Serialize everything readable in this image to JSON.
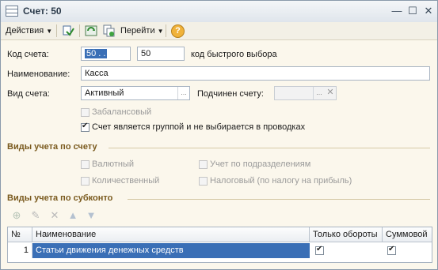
{
  "window": {
    "title": "Счет: 50"
  },
  "toolbar": {
    "actions_label": "Действия",
    "goto_label": "Перейти",
    "help_label": "?"
  },
  "form": {
    "code_label": "Код счета:",
    "code_value": "50 . .",
    "quick_code_value": "50",
    "quick_code_label": "код быстрого выбора",
    "name_label": "Наименование:",
    "name_value": "Касса",
    "type_label": "Вид счета:",
    "type_value": "Активный",
    "parent_label": "Подчинен счету:",
    "parent_value": "",
    "offbalance_label": "Забалансовый",
    "offbalance_checked": false,
    "group_label": "Счет является группой и не выбирается в проводках",
    "group_checked": true
  },
  "accounting_kinds": {
    "title": "Виды учета по счету",
    "currency_label": "Валютный",
    "quantity_label": "Количественный",
    "by_department_label": "Учет по подразделениям",
    "tax_label": "Налоговый (по налогу на прибыль)"
  },
  "subconto": {
    "title": "Виды учета по субконто",
    "columns": [
      "№",
      "Наименование",
      "Только обороты",
      "Суммовой"
    ],
    "rows": [
      {
        "num": "1",
        "name": "Статьи движения денежных средств",
        "turnover_only": true,
        "sum": true
      }
    ]
  },
  "colors": {
    "accent": "#3a6fb6",
    "section": "#7a5a1e",
    "background": "#fbf7ec"
  },
  "icons": [
    "window-icon",
    "minimize-icon",
    "restore-icon",
    "close-icon",
    "post-icon",
    "refresh-icon",
    "copy-icon",
    "help-icon",
    "add-icon",
    "edit-icon",
    "delete-icon",
    "move-up-icon",
    "move-down-icon"
  ]
}
